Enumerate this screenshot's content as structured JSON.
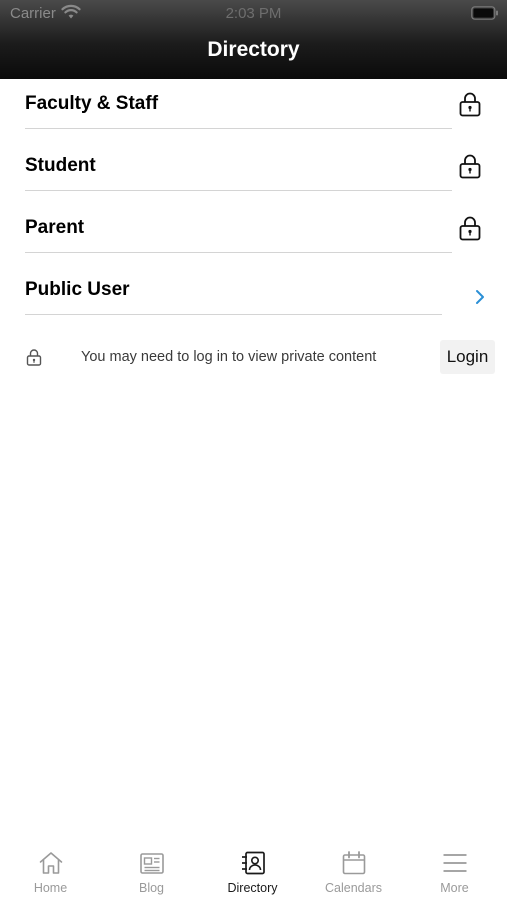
{
  "status_bar": {
    "carrier": "Carrier",
    "time": "2:03 PM",
    "wifi_icon": "wifi-icon",
    "battery_icon": "battery-icon"
  },
  "header": {
    "title": "Directory"
  },
  "directory": {
    "items": [
      {
        "label": "Faculty & Staff",
        "icon": "lock-icon"
      },
      {
        "label": "Student",
        "icon": "lock-icon"
      },
      {
        "label": "Parent",
        "icon": "lock-icon"
      },
      {
        "label": "Public User",
        "icon": "chevron-right-icon"
      }
    ]
  },
  "login_notice": {
    "icon": "lock-icon",
    "text": "You may need to log in to view private content",
    "button_label": "Login"
  },
  "tab_bar": {
    "tabs": [
      {
        "label": "Home",
        "icon": "home-icon",
        "active": false
      },
      {
        "label": "Blog",
        "icon": "newspaper-icon",
        "active": false
      },
      {
        "label": "Directory",
        "icon": "contacts-icon",
        "active": true
      },
      {
        "label": "Calendars",
        "icon": "calendar-icon",
        "active": false
      },
      {
        "label": "More",
        "icon": "menu-icon",
        "active": false
      }
    ]
  },
  "colors": {
    "header_background": "#1c1c1c",
    "header_text": "#ffffff",
    "chevron_accent": "#2a8fd6",
    "tab_active": "#1a1a1a",
    "tab_inactive": "#9a9a9a",
    "divider": "#d4d4d4"
  }
}
